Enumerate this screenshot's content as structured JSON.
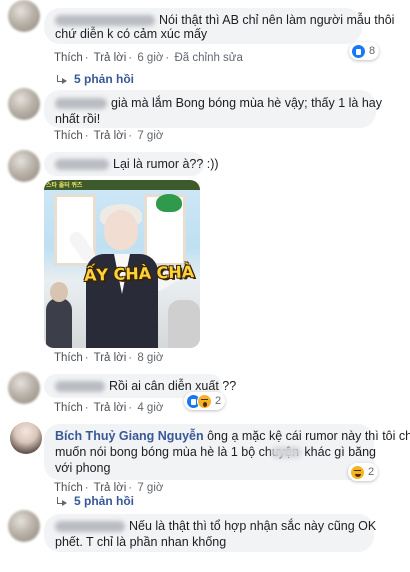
{
  "comments": [
    {
      "text_lines": [
        "Nói thật thì AB chỉ nên làm người mẫu thôi",
        "chứ diễn k có cảm xúc mấy"
      ],
      "actions": [
        "Thích",
        "Trả lời",
        "6 giờ",
        "Đã chỉnh sửa"
      ],
      "reactions": {
        "icons": [
          "like"
        ],
        "count": "8"
      },
      "replies_label": "5 phản hồi"
    },
    {
      "text_lines": [
        "già mà lắm Bong bóng mùa hè vậy; thấy 1 là hay",
        "nhất rồi!"
      ],
      "actions": [
        "Thích",
        "Trả lời",
        "7 giờ"
      ]
    },
    {
      "text_lines": [
        "Lại là rumor à?? :))"
      ],
      "actions": [
        "Thích",
        "Trả lời",
        "8 giờ"
      ],
      "gif_caption": "ẤY CHÀ CHÀ",
      "gif_topbar": "스타 올터 퀴즈"
    },
    {
      "text_lines": [
        "Rồi ai cân diễn xuất ??"
      ],
      "actions": [
        "Thích",
        "Trả lời",
        "4 giờ"
      ],
      "reactions": {
        "icons": [
          "like",
          "haha"
        ],
        "count": "2"
      }
    },
    {
      "author": "Bích Thuỷ Giang Nguyễn",
      "text_lines": [
        "ông ạ mặc kệ cái rumor này thì tôi chỉ",
        "muốn nói bong bóng mùa hè là 1 bộ chuyện",
        "khác gì băng",
        "với phong"
      ],
      "actions": [
        "Thích",
        "Trả lời",
        "7 giờ"
      ],
      "reactions": {
        "icons": [
          "haha"
        ],
        "count": "2"
      },
      "replies_label": "5 phản hồi"
    },
    {
      "text_lines": [
        "Nếu là thật thì tổ hợp nhận sắc này cũng OK",
        "phết. T chỉ là phần nhan khống"
      ]
    }
  ]
}
